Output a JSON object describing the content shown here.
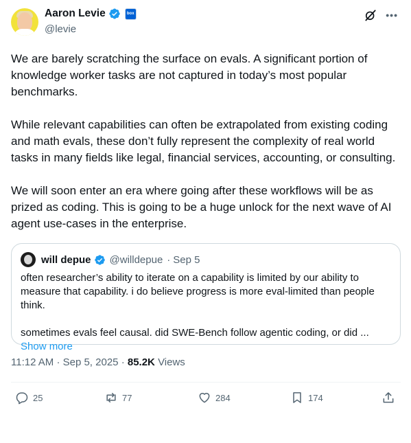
{
  "author": {
    "name": "Aaron Levie",
    "handle": "@levie",
    "affiliate_badge": "box"
  },
  "tweet": {
    "paragraphs": [
      "We are barely scratching the surface on evals. A significant portion of knowledge worker tasks are not captured in today’s most popular benchmarks.",
      "While relevant capabilities can often be extrapolated from existing coding and math evals, these don’t fully represent the complexity of real world tasks in many fields like legal, financial services, accounting, or consulting.",
      "We will soon enter an era where going after these workflows will be as prized as coding. This is going to be a huge unlock for the next wave of AI agent use-cases in the enterprise."
    ]
  },
  "quote": {
    "name": "will depue",
    "handle": "@willdepue",
    "date": "Sep 5",
    "paragraphs": [
      "often researcher’s ability to iterate on a capability is limited by our ability to measure that capability. i do believe progress is more eval-limited than people think.",
      "sometimes evals feel causal. did SWE-Bench follow agentic coding, or did ..."
    ],
    "show_more": "Show more"
  },
  "meta": {
    "time": "11:12 AM",
    "date": "Sep 5, 2025",
    "views_count": "85.2K",
    "views_label": "Views"
  },
  "actions": {
    "replies": "25",
    "reposts": "77",
    "likes": "284",
    "bookmarks": "174"
  },
  "icons": {
    "verified": "verified-badge-icon",
    "grok": "grok-icon",
    "more": "more-icon",
    "reply": "reply-icon",
    "repost": "repost-icon",
    "like": "like-icon",
    "bookmark": "bookmark-icon",
    "share": "share-icon"
  },
  "colors": {
    "accent": "#1d9bf0",
    "text": "#0f1419",
    "secondary": "#536471",
    "border": "#cfd9de"
  }
}
